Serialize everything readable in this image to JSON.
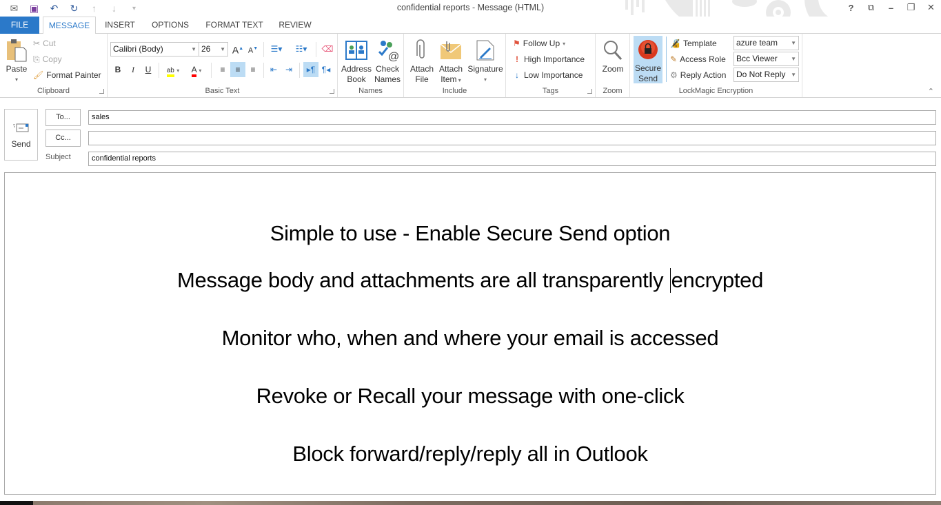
{
  "window": {
    "title": "confidential reports - Message (HTML)",
    "quick_access": [
      "envelope-icon",
      "save-icon",
      "undo-icon",
      "redo-icon",
      "up-arrow-icon",
      "down-arrow-icon",
      "customize-icon"
    ],
    "controls": {
      "help": "?",
      "ribbon_display": "⧉",
      "minimize": "–",
      "restore": "❐",
      "close": "✕"
    }
  },
  "tabs": [
    {
      "label": "FILE"
    },
    {
      "label": "MESSAGE",
      "active": true
    },
    {
      "label": "INSERT"
    },
    {
      "label": "OPTIONS"
    },
    {
      "label": "FORMAT TEXT"
    },
    {
      "label": "REVIEW"
    }
  ],
  "ribbon": {
    "clipboard": {
      "label": "Clipboard",
      "paste": "Paste",
      "cut": "Cut",
      "copy": "Copy",
      "format_painter": "Format Painter"
    },
    "basic_text": {
      "label": "Basic Text",
      "font": "Calibri (Body)",
      "size": "26",
      "bold": "B",
      "italic": "I",
      "underline": "U",
      "highlight_color": "#ffff00",
      "font_color": "#ff0000",
      "alignment": "center"
    },
    "names": {
      "label": "Names",
      "address_book": [
        "Address",
        "Book"
      ],
      "check_names": [
        "Check",
        "Names"
      ]
    },
    "include": {
      "label": "Include",
      "attach_file": [
        "Attach",
        "File"
      ],
      "attach_item": [
        "Attach",
        "Item"
      ],
      "signature": "Signature"
    },
    "tags": {
      "label": "Tags",
      "follow_up": "Follow Up",
      "high": "High Importance",
      "low": "Low Importance"
    },
    "zoom": {
      "label": "Zoom",
      "zoom": "Zoom"
    },
    "lockmagic": {
      "label": "LockMagic Encryption",
      "secure_send": [
        "Secure",
        "Send"
      ],
      "template_label": "Template",
      "template_value": "azure team",
      "access_role_label": "Access Role",
      "access_role_value": "Bcc Viewer",
      "reply_action_label": "Reply Action",
      "reply_action_value": "Do Not Reply"
    }
  },
  "compose": {
    "send": "Send",
    "to_button": "To...",
    "cc_button": "Cc...",
    "subject_label": "Subject",
    "to_value": "sales",
    "cc_value": "",
    "subject_value": "confidential reports"
  },
  "body_lines": [
    "Simple to use - Enable Secure Send option",
    "Message body and attachments are all transparently",
    "encrypted",
    "Monitor who, when and where your email is accessed",
    "Revoke or Recall your message with one-click",
    "Block forward/reply/reply all in Outlook"
  ]
}
